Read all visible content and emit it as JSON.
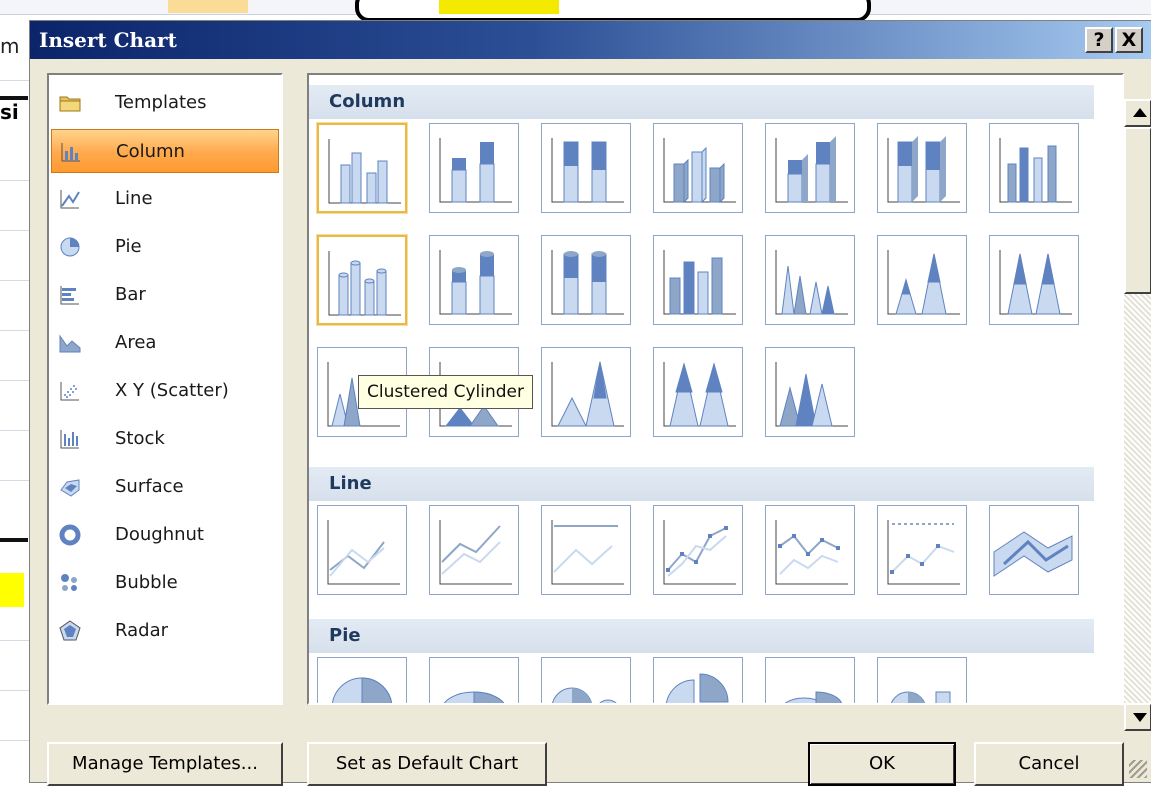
{
  "dialog": {
    "title": "Insert Chart",
    "help_label": "?",
    "close_label": "X"
  },
  "background": {
    "cell_fragment_1": "m",
    "cell_fragment_2": "si"
  },
  "categories": [
    {
      "label": "Templates",
      "icon": "folder-icon"
    },
    {
      "label": "Column",
      "icon": "column-chart-icon",
      "selected": true
    },
    {
      "label": "Line",
      "icon": "line-chart-icon"
    },
    {
      "label": "Pie",
      "icon": "pie-chart-icon"
    },
    {
      "label": "Bar",
      "icon": "bar-chart-icon"
    },
    {
      "label": "Area",
      "icon": "area-chart-icon"
    },
    {
      "label": "X Y (Scatter)",
      "icon": "scatter-chart-icon"
    },
    {
      "label": "Stock",
      "icon": "stock-chart-icon"
    },
    {
      "label": "Surface",
      "icon": "surface-chart-icon"
    },
    {
      "label": "Doughnut",
      "icon": "doughnut-chart-icon"
    },
    {
      "label": "Bubble",
      "icon": "bubble-chart-icon"
    },
    {
      "label": "Radar",
      "icon": "radar-chart-icon"
    }
  ],
  "gallery": {
    "sections": [
      {
        "title": "Column"
      },
      {
        "title": "Line"
      },
      {
        "title": "Pie"
      }
    ],
    "tooltip": "Clustered Cylinder"
  },
  "buttons": {
    "manage_templates": "Manage Templates...",
    "set_default": "Set as Default Chart",
    "ok": "OK",
    "cancel": "Cancel"
  },
  "colors": {
    "title_start": "#0b246a",
    "title_end": "#a6caf0",
    "selected_start": "#ffd48c",
    "selected_end": "#ff9a2e",
    "thumb_fill": "#5f83c0",
    "thumb_light": "#c9d9f0"
  }
}
